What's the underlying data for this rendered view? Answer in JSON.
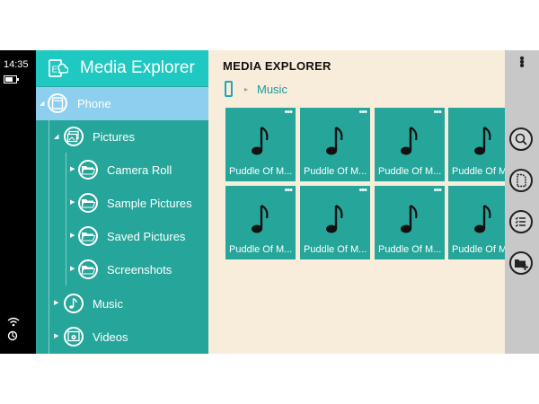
{
  "status": {
    "time": "14:35",
    "battery_level": 0.7,
    "icons": [
      "battery-icon",
      "wifi-icon",
      "sync-icon"
    ]
  },
  "app": {
    "title": "Media Explorer",
    "logo": "media-explorer-logo"
  },
  "sidebar": {
    "items": [
      {
        "label": "Phone",
        "icon": "phone-icon",
        "selected": true
      },
      {
        "label": "Pictures",
        "icon": "pictures-icon"
      },
      {
        "label": "Camera Roll",
        "icon": "folder-icon"
      },
      {
        "label": "Sample Pictures",
        "icon": "folder-icon"
      },
      {
        "label": "Saved Pictures",
        "icon": "folder-icon"
      },
      {
        "label": "Screenshots",
        "icon": "folder-icon"
      },
      {
        "label": "Music",
        "icon": "music-icon"
      },
      {
        "label": "Videos",
        "icon": "video-icon"
      }
    ]
  },
  "main": {
    "title": "MEDIA EXPLORER",
    "breadcrumb": {
      "icon": "phone-icon",
      "separator": "▸",
      "label": "Music"
    },
    "tiles": [
      {
        "label": "Puddle Of M..."
      },
      {
        "label": "Puddle Of M..."
      },
      {
        "label": "Puddle Of M..."
      },
      {
        "label": "Puddle Of M..."
      },
      {
        "label": "Puddle Of M..."
      },
      {
        "label": "Puddle Of M..."
      },
      {
        "label": "Puddle Of M..."
      },
      {
        "label": "Puddle Of M..."
      }
    ],
    "tile_icon": "music-note-icon"
  },
  "appbar": {
    "buttons": [
      "search-icon",
      "document-icon",
      "list-icon",
      "add-folder-icon"
    ],
    "more": "more-icon"
  },
  "colors": {
    "sidebar": "#26a69a",
    "header": "#1fc8c0",
    "selected": "#8ecff0",
    "content_bg": "#f8ecda",
    "accent": "#1a9aa0",
    "appbar": "#c8c8c8"
  }
}
